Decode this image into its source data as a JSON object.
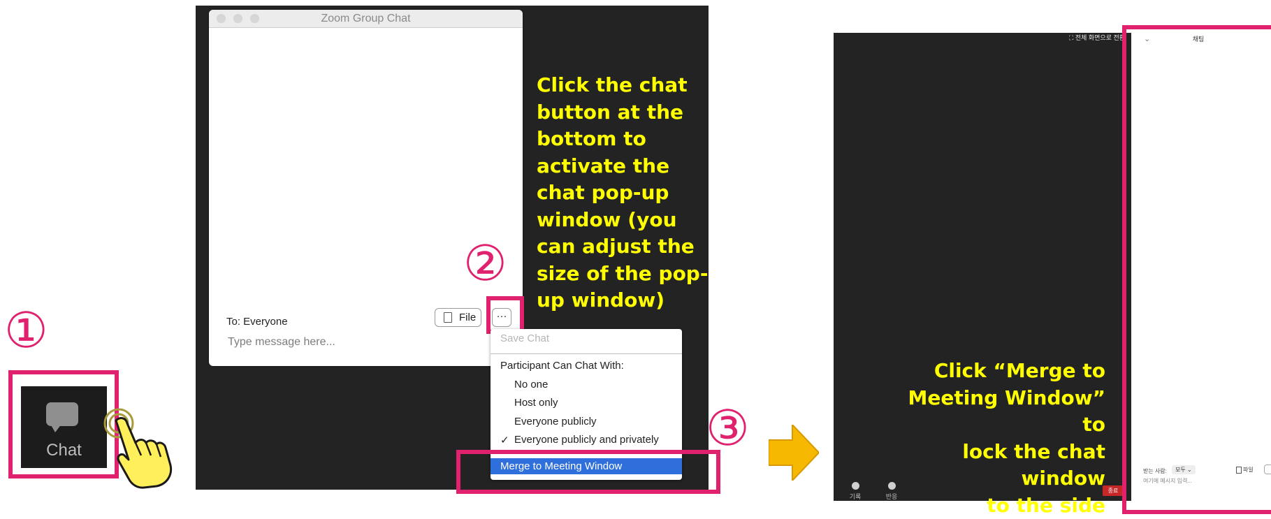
{
  "steps": {
    "one": "①",
    "two": "②",
    "three": "③"
  },
  "chat_button": {
    "label": "Chat"
  },
  "popup": {
    "title": "Zoom Group Chat",
    "to_label": "To: Everyone",
    "file_label": "File",
    "more_label": "···",
    "message_placeholder": "Type message here..."
  },
  "menu": {
    "save_chat": "Save Chat",
    "participant_heading": "Participant Can Chat With:",
    "options": [
      "No one",
      "Host only",
      "Everyone publicly",
      "Everyone publicly and privately"
    ],
    "selected_mark": "✓",
    "merge": "Merge to Meeting Window"
  },
  "instructions": {
    "popup_lines": [
      "Click the chat",
      "button at the",
      "bottom to",
      "activate the",
      "chat pop-up",
      "window (you",
      "can adjust the",
      "size of the pop-",
      "up window)"
    ],
    "merge_lines": [
      "Click “Merge to",
      "Meeting Window”  to",
      "lock the chat window",
      "to the side"
    ]
  },
  "meeting": {
    "fullscreen_label": "전체 화면으로 전환",
    "record_label": "기록",
    "reactions_label": "반응",
    "end_label": "종료"
  },
  "side_chat": {
    "title": "채팅",
    "to_label": "받는 사람:",
    "to_value": "모두 ⌄",
    "file_label": "파일",
    "message_placeholder": "여기에 메시지 입력..."
  },
  "colors": {
    "highlight": "#e0226e",
    "instruction_text": "#ffff00",
    "arrow": "#f6b800",
    "merge_selected": "#2f6fdc",
    "end_button": "#c62828"
  }
}
